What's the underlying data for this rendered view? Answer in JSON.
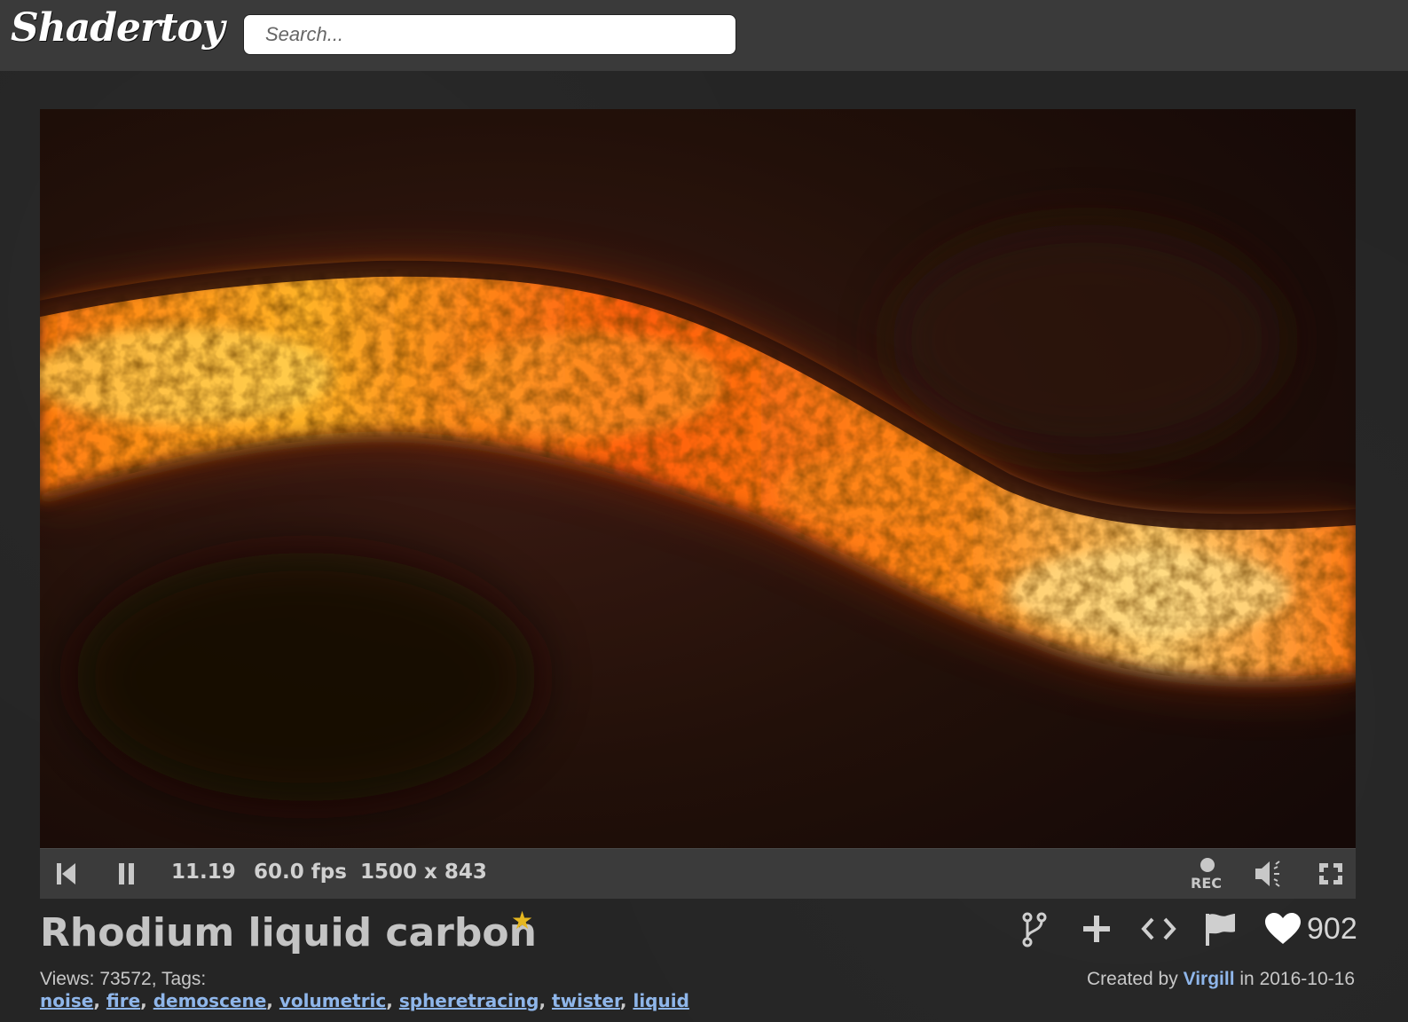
{
  "header": {
    "logo": "Shadertoy",
    "search_placeholder": "Search..."
  },
  "player": {
    "time": "11.19",
    "fps": "60.0 fps",
    "resolution": "1500 x 843",
    "rec_label": "REC"
  },
  "shader": {
    "title": "Rhodium liquid carbon",
    "views_label": "Views:",
    "views": "73572",
    "tags_label": "Tags:",
    "tags": [
      "noise",
      "fire",
      "demoscene",
      "volumetric",
      "spheretracing",
      "twister",
      "liquid"
    ],
    "likes": "902",
    "created_prefix": "Created by",
    "author": "Virgill",
    "created_mid": "in",
    "date": "2016-10-16"
  },
  "colors": {
    "header_bg": "#3a3a3a",
    "page_bg": "#252525",
    "link": "#8fb6ea",
    "star": "#e5b720"
  },
  "icons": {
    "rewind": "skip-to-start-icon",
    "pause": "pause-icon",
    "rec": "record-icon",
    "volume": "volume-icon",
    "fullscreen": "fullscreen-icon",
    "fork": "fork-icon",
    "add": "plus-icon",
    "embed": "code-icon",
    "report": "flag-icon",
    "like": "heart-icon"
  }
}
